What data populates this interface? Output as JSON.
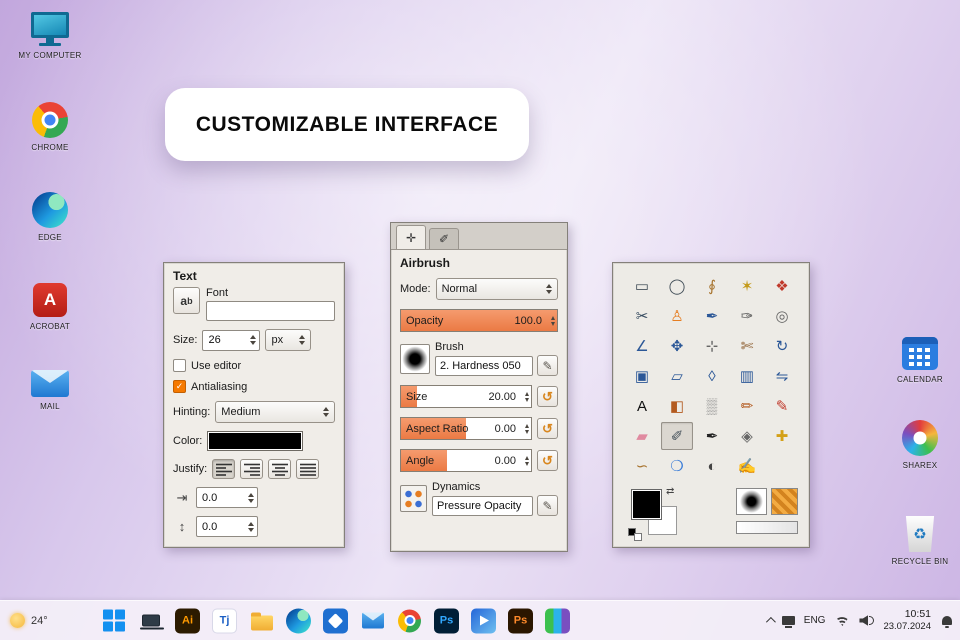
{
  "banner": {
    "text": "CUSTOMIZABLE INTERFACE"
  },
  "desktop": {
    "left_icons": [
      {
        "label": "MY COMPUTER"
      },
      {
        "label": "CHROME"
      },
      {
        "label": "EDGE"
      },
      {
        "label": "ACROBAT"
      },
      {
        "label": "MAIL"
      }
    ],
    "right_icons": [
      {
        "label": "CALENDAR"
      },
      {
        "label": "SHAREX"
      },
      {
        "label": "RECYCLE BIN"
      }
    ],
    "acrobat_letter": "A",
    "recycle_glyph": "♻"
  },
  "text_tool": {
    "title": "Text",
    "font": {
      "label": "Font",
      "value": ""
    },
    "size": {
      "label": "Size:",
      "value": "26",
      "unit": "px"
    },
    "use_editor": {
      "label": "Use editor",
      "checked": false
    },
    "antialiasing": {
      "label": "Antialiasing",
      "checked": true,
      "check_glyph": "✓"
    },
    "hinting": {
      "label": "Hinting:",
      "value": "Medium"
    },
    "color": {
      "label": "Color:",
      "value": "#000000"
    },
    "justify": {
      "label": "Justify:"
    },
    "indent": {
      "value": "0.0"
    },
    "line_spacing": {
      "value": "0.0"
    },
    "icons": {
      "indent": "⇥",
      "line_spacing": "↕"
    }
  },
  "airbrush_tool": {
    "tabs": [
      {
        "icon": "✛"
      },
      {
        "icon": "✐"
      }
    ],
    "title": "Airbrush",
    "mode": {
      "label": "Mode:",
      "value": "Normal"
    },
    "opacity": {
      "label": "Opacity",
      "value": "100.0",
      "fill": "100%"
    },
    "brush": {
      "label": "Brush",
      "value": "2. Hardness 050"
    },
    "size": {
      "label": "Size",
      "value": "20.00",
      "fill": "12%"
    },
    "aspect_ratio": {
      "label": "Aspect Ratio",
      "value": "0.00",
      "fill": "50%"
    },
    "angle": {
      "label": "Angle",
      "value": "0.00",
      "fill": "35%"
    },
    "dynamics": {
      "label": "Dynamics",
      "value": "Pressure Opacity"
    },
    "icons": {
      "reset": "↺",
      "edit": "✎"
    }
  },
  "toolbox": {
    "selected_tool": "airbrush",
    "icons": {
      "swap_colors": "⇄"
    },
    "tools": [
      {
        "name": "rectangle-select",
        "glyph": "▭",
        "color": "#44505a"
      },
      {
        "name": "ellipse-select",
        "glyph": "◯",
        "color": "#44505a"
      },
      {
        "name": "free-select",
        "glyph": "∮",
        "color": "#a8742f"
      },
      {
        "name": "fuzzy-select",
        "glyph": "✶",
        "color": "#c49a1a"
      },
      {
        "name": "select-by-color",
        "glyph": "❖",
        "color": "#c0392b"
      },
      {
        "name": "scissors-select",
        "glyph": "✂",
        "color": "#34495e"
      },
      {
        "name": "foreground-select",
        "glyph": "♙",
        "color": "#e67e22"
      },
      {
        "name": "paths",
        "glyph": "✒",
        "color": "#2b5797"
      },
      {
        "name": "color-picker",
        "glyph": "✑",
        "color": "#555555"
      },
      {
        "name": "zoom",
        "glyph": "◎",
        "color": "#666666"
      },
      {
        "name": "measure",
        "glyph": "∠",
        "color": "#2b5797"
      },
      {
        "name": "move",
        "glyph": "✥",
        "color": "#2b5797"
      },
      {
        "name": "alignment",
        "glyph": "⊹",
        "color": "#555555"
      },
      {
        "name": "crop",
        "glyph": "✄",
        "color": "#8a5a2b"
      },
      {
        "name": "rotate",
        "glyph": "↻",
        "color": "#2b5797"
      },
      {
        "name": "scale",
        "glyph": "▣",
        "color": "#2b5797"
      },
      {
        "name": "shear",
        "glyph": "▱",
        "color": "#2b5797"
      },
      {
        "name": "perspective",
        "glyph": "◊",
        "color": "#2b5797"
      },
      {
        "name": "transform-3d",
        "glyph": "▥",
        "color": "#2b5797"
      },
      {
        "name": "flip",
        "glyph": "⇋",
        "color": "#2b5797"
      },
      {
        "name": "text",
        "glyph": "A",
        "color": "#111111"
      },
      {
        "name": "bucket-fill",
        "glyph": "◧",
        "color": "#b35a1f"
      },
      {
        "name": "gradient",
        "glyph": "▒",
        "color": "#888888"
      },
      {
        "name": "pencil",
        "glyph": "✏",
        "color": "#b35a1f"
      },
      {
        "name": "paintbrush",
        "glyph": "✎",
        "color": "#c0392b"
      },
      {
        "name": "eraser",
        "glyph": "▰",
        "color": "#e08aa0"
      },
      {
        "name": "airbrush",
        "glyph": "✐",
        "color": "#44505a",
        "selected": true
      },
      {
        "name": "ink",
        "glyph": "✒",
        "color": "#222222"
      },
      {
        "name": "clone",
        "glyph": "◈",
        "color": "#666666"
      },
      {
        "name": "heal",
        "glyph": "✚",
        "color": "#d4a017"
      },
      {
        "name": "smudge",
        "glyph": "∽",
        "color": "#a8742f"
      },
      {
        "name": "blur-sharpen",
        "glyph": "❍",
        "color": "#3b7dd8"
      },
      {
        "name": "dodge-burn",
        "glyph": "◐",
        "color": "#444444"
      },
      {
        "name": "mypaint-brush",
        "glyph": "✍",
        "color": "#555555"
      }
    ]
  },
  "taskbar": {
    "weather": {
      "temp": "24°"
    },
    "apps": {
      "illustrator": "Ai",
      "tourbox": "Tj",
      "photoshop": "Ps",
      "photoshop_express": "Ps"
    },
    "tray": {
      "language": "ENG",
      "time": "10:51",
      "date": "23.07.2024"
    }
  }
}
